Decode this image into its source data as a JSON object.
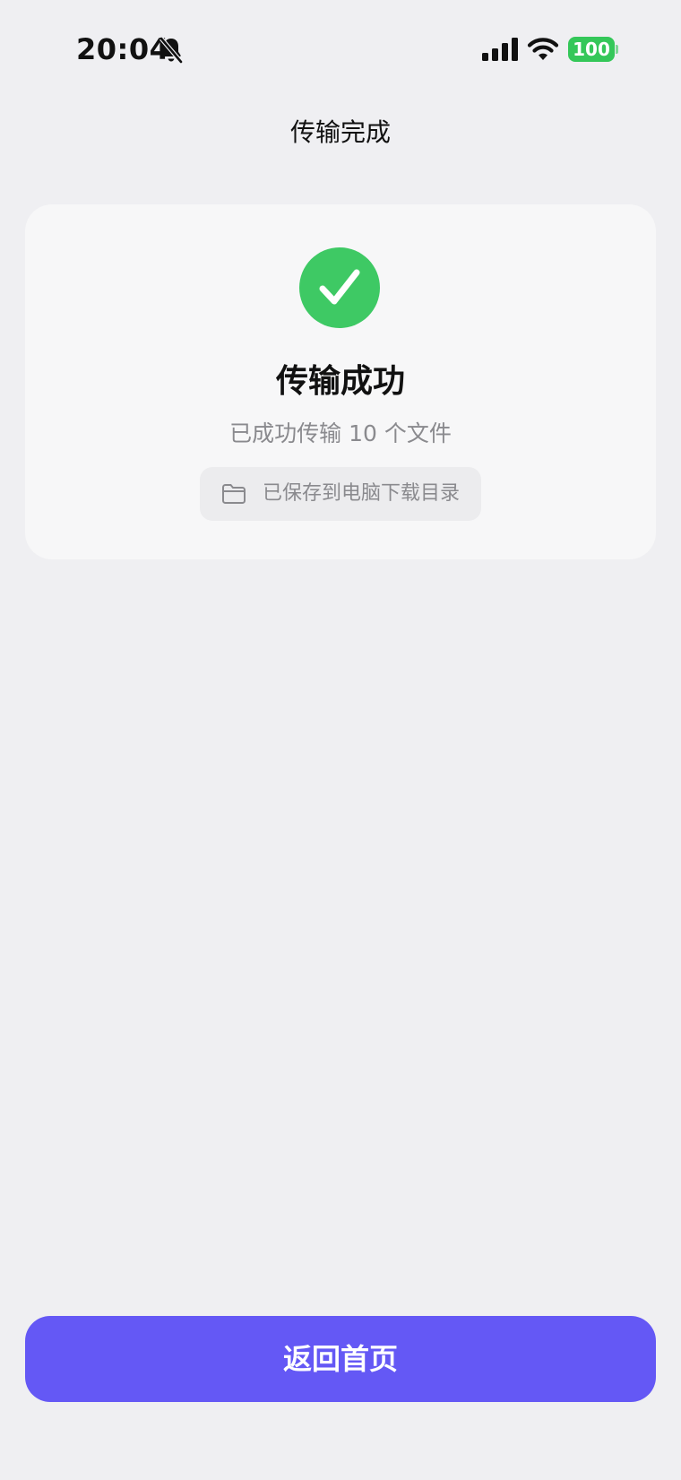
{
  "status_bar": {
    "time": "20:04",
    "battery_level": "100",
    "icons": [
      "bell-slash-icon",
      "cellular-signal-icon",
      "wifi-icon",
      "battery-icon"
    ]
  },
  "nav": {
    "title": "传输完成"
  },
  "result": {
    "icon": "check-circle-icon",
    "title": "传输成功",
    "subtitle": "已成功传输 10 个文件",
    "save_location": {
      "icon": "folder-icon",
      "text": "已保存到电脑下载目录"
    }
  },
  "actions": {
    "home_label": "返回首页"
  },
  "colors": {
    "background": "#efeff2",
    "card": "#f7f7f8",
    "success": "#3ec964",
    "battery": "#34c759",
    "primary_button": "#6458f5",
    "muted_text": "#8a8a8e"
  }
}
